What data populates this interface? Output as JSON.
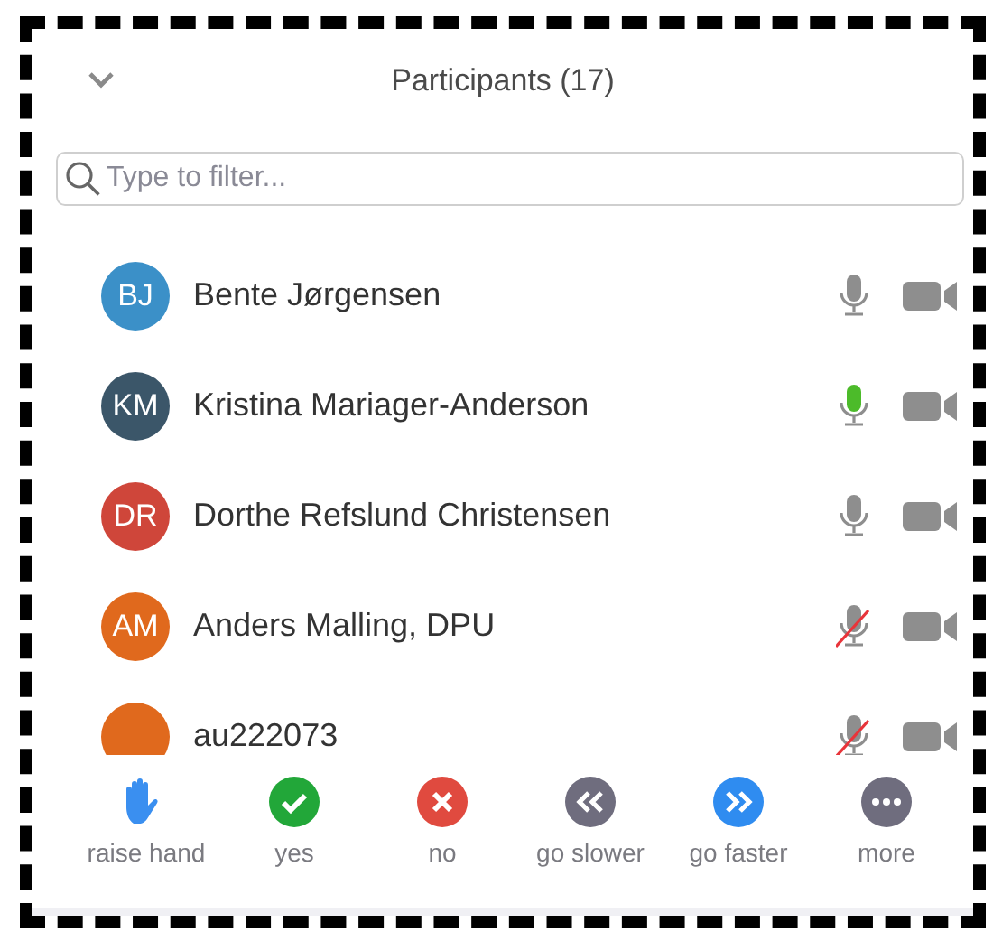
{
  "panel": {
    "title": "Participants (17)"
  },
  "search": {
    "placeholder": "Type to filter..."
  },
  "participants": [
    {
      "initials": "BJ",
      "color": "#3b90c8",
      "name": "Bente Jørgensen",
      "speaking": false,
      "muted": false
    },
    {
      "initials": "KM",
      "color": "#3b5669",
      "name": "Kristina Mariager-Anderson",
      "speaking": true,
      "muted": false
    },
    {
      "initials": "DR",
      "color": "#cf463a",
      "name": "Dorthe Refslund Christensen",
      "speaking": false,
      "muted": false
    },
    {
      "initials": "AM",
      "color": "#e0691d",
      "name": "Anders Malling, DPU",
      "speaking": false,
      "muted": true
    },
    {
      "color": "#e0691d",
      "name": "au222073",
      "speaking": false,
      "muted": true
    }
  ],
  "reactions": [
    {
      "kind": "hand",
      "label": "raise hand",
      "color": "#3a8ff0"
    },
    {
      "kind": "yes",
      "label": "yes",
      "color": "#22a739"
    },
    {
      "kind": "no",
      "label": "no",
      "color": "#e04a3f"
    },
    {
      "kind": "slower",
      "label": "go slower",
      "color": "#6f6d7e"
    },
    {
      "kind": "faster",
      "label": "go faster",
      "color": "#2f8cf0"
    },
    {
      "kind": "more",
      "label": "more",
      "color": "#6f6d7e"
    }
  ]
}
